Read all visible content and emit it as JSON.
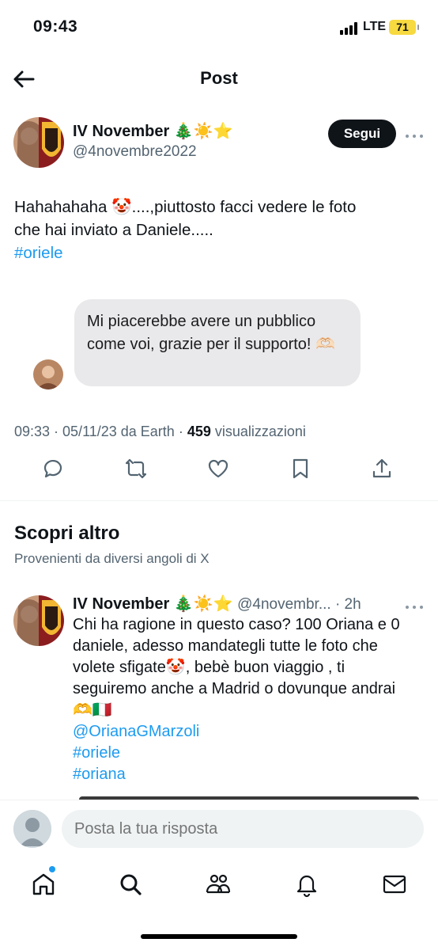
{
  "status_bar": {
    "time": "09:43",
    "network": "LTE",
    "battery": "71"
  },
  "header": {
    "title": "Post",
    "back_icon": "arrow-left-icon"
  },
  "post": {
    "author_name": "IV November",
    "author_emojis": "🎄☀️⭐",
    "author_handle": "@4novembre2022",
    "follow_label": "Segui",
    "text_line1": "Hahahahaha 🤡....,piuttosto facci vedere le foto",
    "text_line2": "che hai inviato a Daniele.....",
    "hashtag": "#oriele",
    "media_message": "Mi piacerebbe avere un pubblico come voi, grazie per il supporto! 🫶🏻",
    "time": "09:33 · 05/11/23 da Earth · ",
    "views_count": "459",
    "views_label": " visualizzazioni"
  },
  "actions": [
    "reply-icon",
    "retweet-icon",
    "like-icon",
    "bookmark-icon",
    "share-icon"
  ],
  "discover": {
    "title": "Scopri altro",
    "subtitle": "Provenienti da diversi angoli di X"
  },
  "recommended": {
    "author_name": "IV November",
    "author_emojis": "🎄☀️⭐",
    "handle_time": "@4novembr... · 2h",
    "line1": "Chi ha ragione in questo caso? 100 Oriana e 0",
    "line2": "daniele, adesso mandategli tutte le foto che",
    "line3": "volete sfigate🤡, bebè buon viaggio , ti",
    "line4": "seguiremo anche a Madrid o dovunque andrai",
    "line5": "🫶🇮🇹",
    "mention": "@OrianaGMarzoli",
    "tag1": "#oriele",
    "tag2": "#oriana"
  },
  "reply": {
    "placeholder": "Posta la tua risposta"
  },
  "tabs": [
    "home-icon",
    "search-icon",
    "communities-icon",
    "notifications-icon",
    "messages-icon"
  ],
  "colors": {
    "accent": "#1d9bf0",
    "text": "#0f1419",
    "muted": "#536471",
    "bubble": "#e9e9eb"
  }
}
